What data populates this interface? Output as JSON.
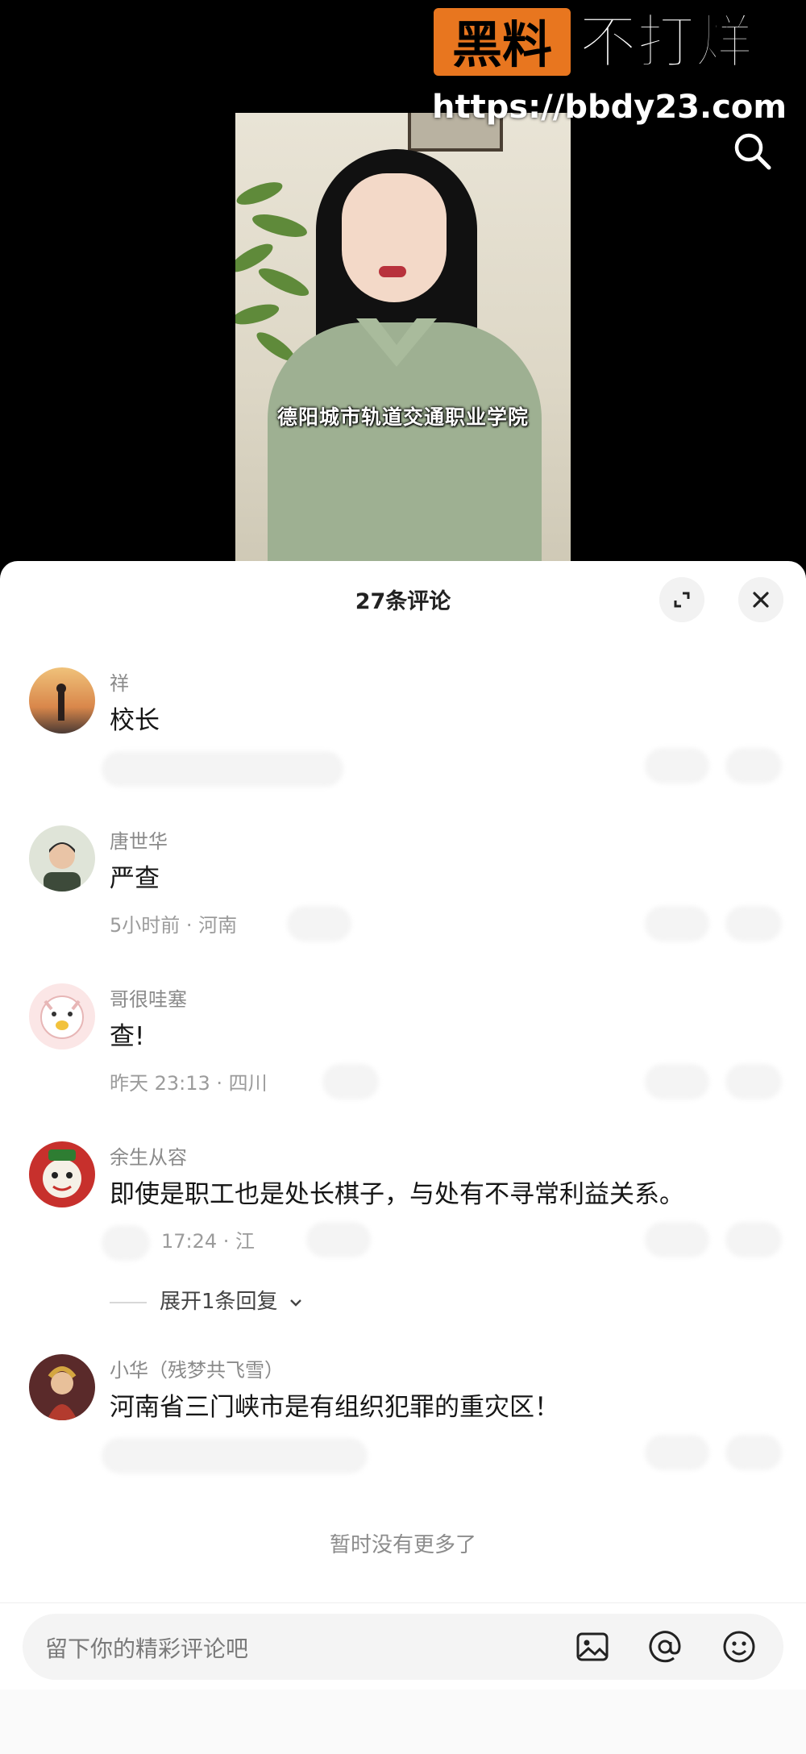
{
  "watermark": {
    "badge": "黑料",
    "text": "不打烊",
    "url": "https://bbdy23.com"
  },
  "video": {
    "subtitle": "德阳城市轨道交通职业学院"
  },
  "sheet": {
    "title": "27条评论"
  },
  "comments": [
    {
      "name": "祥",
      "text": "校长",
      "meta": ""
    },
    {
      "name": "唐世华",
      "text": "严查",
      "meta": "5小时前 · 河南"
    },
    {
      "name": "哥很哇塞",
      "text": "查!",
      "meta": "昨天 23:13 · 四川"
    },
    {
      "name": "余生从容",
      "text": "即使是职工也是处长棋子，与处有不寻常利益关系。",
      "meta": "17:24 · 江",
      "reply_label": "展开1条回复"
    },
    {
      "name": "小华（残梦共飞雪）",
      "text": "河南省三门峡市是有组织犯罪的重灾区！",
      "meta": ""
    }
  ],
  "footer": {
    "no_more": "暂时没有更多了"
  },
  "input": {
    "placeholder": "留下你的精彩评论吧"
  },
  "colors": {
    "watermark_orange": "#e8761f",
    "sheet_bg": "#ffffff",
    "text_primary": "#161616",
    "text_secondary": "#8a8a8a"
  },
  "icons": [
    "search-icon",
    "expand-icon",
    "close-icon",
    "chevron-down-icon",
    "image-icon",
    "at-icon",
    "emoji-icon"
  ]
}
